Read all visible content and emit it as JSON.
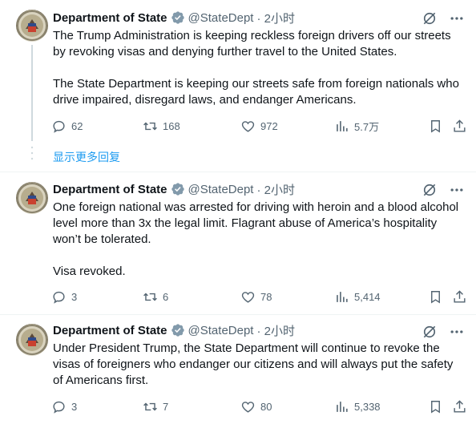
{
  "show_more_replies": "显示更多回复",
  "colors": {
    "accent": "#1d9bf0",
    "text": "#0f1419",
    "muted": "#536471",
    "verified_gold": "#829aab"
  },
  "tweets": [
    {
      "author": "Department of State",
      "handle": "@StateDept",
      "time": "· 2小时",
      "paragraphs": [
        "The Trump Administration is keeping reckless foreign drivers off our streets by revoking visas and denying further travel to the United States.",
        "The State Department is keeping our streets safe from foreign nationals who drive impaired, disregard laws, and endanger Americans."
      ],
      "replies": "62",
      "reposts": "168",
      "likes": "972",
      "views": "5.7万"
    },
    {
      "author": "Department of State",
      "handle": "@StateDept",
      "time": "· 2小时",
      "paragraphs": [
        "One foreign national was arrested for driving with heroin and a blood alcohol level more than 3x the legal limit. Flagrant abuse of America’s hospitality won’t be tolerated.",
        "Visa revoked."
      ],
      "replies": "3",
      "reposts": "6",
      "likes": "78",
      "views": "5,414"
    },
    {
      "author": "Department of State",
      "handle": "@StateDept",
      "time": "· 2小时",
      "paragraphs": [
        "Under President Trump, the State Department will continue to revoke the visas of foreigners who endanger our citizens and will always put the safety of Americans first."
      ],
      "replies": "3",
      "reposts": "7",
      "likes": "80",
      "views": "5,338"
    }
  ],
  "icons": {
    "verified": "verified-badge-icon",
    "grok": "grok-icon",
    "more": "more-icon",
    "reply": "reply-icon",
    "repost": "repost-icon",
    "like": "like-icon",
    "views": "views-icon",
    "bookmark": "bookmark-icon",
    "share": "share-icon"
  }
}
